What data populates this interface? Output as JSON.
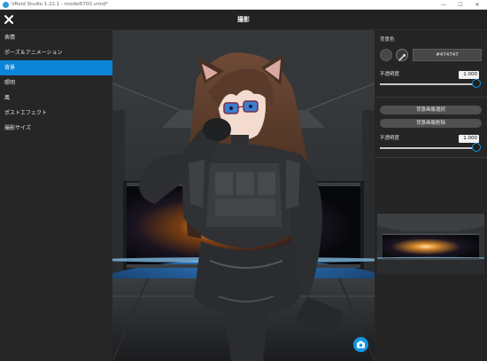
{
  "window": {
    "title": "VRoid Studio 1.22.1 - model6700.vroid*",
    "minimize": "—",
    "maximize": "☐",
    "close": "✕"
  },
  "header": {
    "title": "撮影"
  },
  "sidebar": {
    "items": [
      {
        "label": "表情",
        "selected": false
      },
      {
        "label": "ポーズ＆アニメーション",
        "selected": false
      },
      {
        "label": "背景",
        "selected": true
      },
      {
        "label": "照明",
        "selected": false
      },
      {
        "label": "風",
        "selected": false
      },
      {
        "label": "ポストエフェクト",
        "selected": false
      },
      {
        "label": "撮影サイズ",
        "selected": false
      }
    ]
  },
  "right_panel": {
    "bg_color_label": "背景色",
    "bg_color_value": "#474747",
    "opacity_label": "不透明度",
    "opacity_value": "1.000",
    "opacity_fraction": 1.0,
    "select_image_button": "背景画像選択",
    "delete_image_button": "背景画像削除",
    "image_opacity_label": "不透明度",
    "image_opacity_value": "1.000",
    "image_opacity_fraction": 1.0
  },
  "colors": {
    "accent": "#0a84d6",
    "panel": "#252525",
    "sidebar": "#262626"
  },
  "icons": {
    "close": "close-icon",
    "eyedropper": "eyedropper-icon",
    "camera": "camera-icon"
  }
}
